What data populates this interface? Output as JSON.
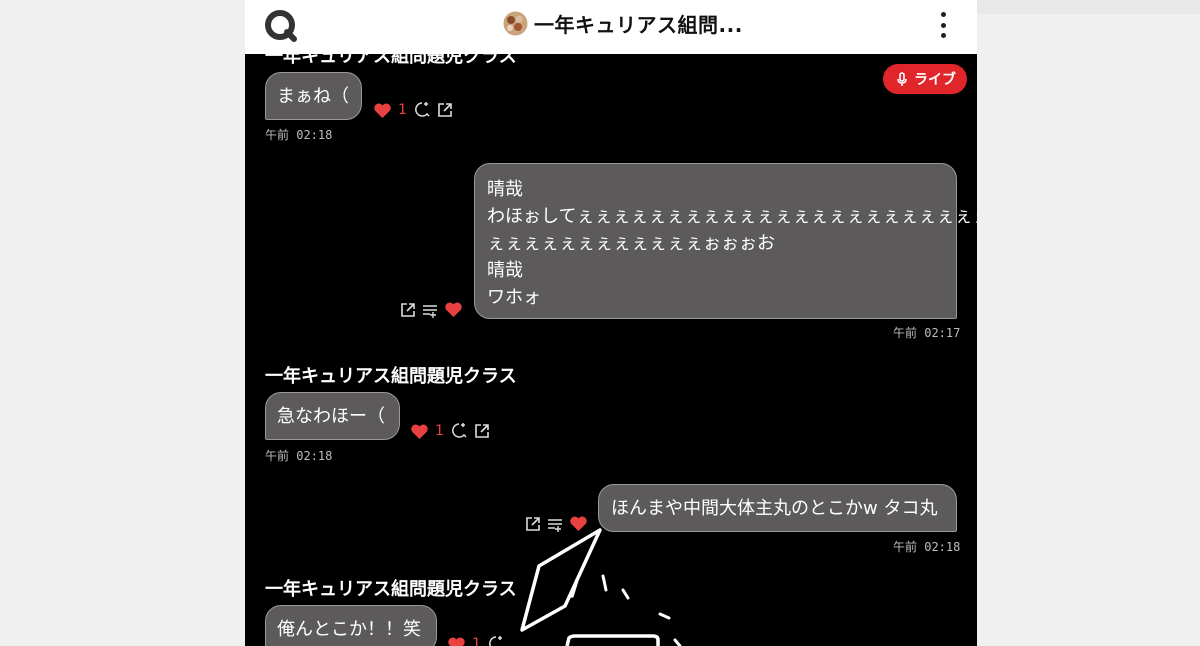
{
  "header": {
    "title": "一年キュリアス組問...",
    "icons": {
      "search": "search-icon",
      "menu": "kebab-menu-icon"
    }
  },
  "live_badge": {
    "label": "ライブ",
    "icon": "mic-icon"
  },
  "messages": [
    {
      "direction": "in",
      "sender": "一年キュリアス組問題児クラス",
      "text": "まぁね（",
      "likes": "1",
      "time": "午前 02:18"
    },
    {
      "direction": "out",
      "lines": [
        "晴哉",
        "わほぉしてぇぇぇぇぇぇぇぇぇぇぇぇぇぇぇぇぇぇぇぇぇぇぇ",
        "ぇぇぇぇぇぇぇぇぇぇぇぇぉぉぉお",
        "晴哉",
        "ワホォ"
      ],
      "time": "午前 02:17"
    },
    {
      "direction": "in",
      "sender": "一年キュリアス組問題児クラス",
      "text": "急なわほー（",
      "likes": "1",
      "time": "午前 02:18"
    },
    {
      "direction": "out",
      "text": "ほんまや中間大体主丸のとこかw タコ丸",
      "time": "午前 02:18"
    },
    {
      "direction": "in",
      "sender": "一年キュリアス組問題児クラス",
      "text": "俺んとこか！！笑",
      "likes": "1"
    }
  ],
  "colors": {
    "accent": "#e0262b",
    "heart": "#e8413f",
    "bubble": "#5c5a5a",
    "background": "#000000"
  }
}
